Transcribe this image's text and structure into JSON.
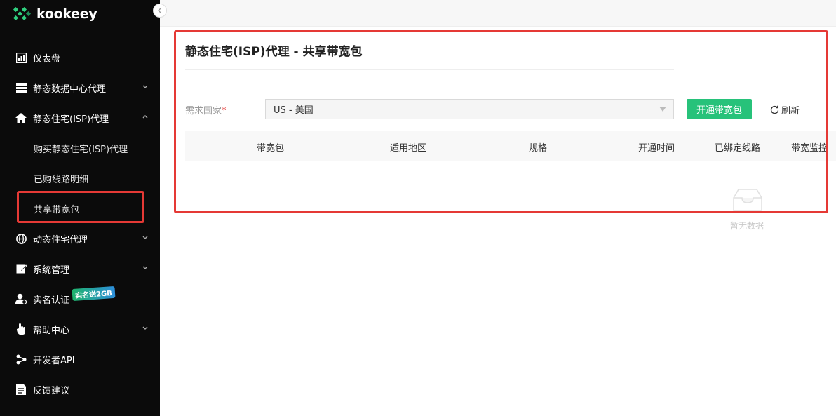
{
  "brand": {
    "name": "kookeey"
  },
  "sidebar": {
    "items": [
      {
        "label": "仪表盘",
        "icon": "dashboard-chart-icon",
        "expandable": false
      },
      {
        "label": "静态数据中心代理",
        "icon": "server-list-icon",
        "expandable": true,
        "expanded": false
      },
      {
        "label": "静态住宅(ISP)代理",
        "icon": "home-icon",
        "expandable": true,
        "expanded": true
      },
      {
        "label": "动态住宅代理",
        "icon": "globe-icon",
        "expandable": true,
        "expanded": false
      },
      {
        "label": "系统管理",
        "icon": "edit-icon",
        "expandable": true,
        "expanded": false
      },
      {
        "label": "实名认证",
        "icon": "user-verify-icon",
        "expandable": false
      },
      {
        "label": "帮助中心",
        "icon": "hand-pointer-icon",
        "expandable": true,
        "expanded": false
      },
      {
        "label": "开发者API",
        "icon": "share-nodes-icon",
        "expandable": false
      },
      {
        "label": "反馈建议",
        "icon": "feedback-doc-icon",
        "expandable": false
      }
    ],
    "submenu": [
      {
        "label": "购买静态住宅(ISP)代理"
      },
      {
        "label": "已购线路明细"
      },
      {
        "label": "共享带宽包",
        "active": true
      }
    ],
    "verify_badge": "实名送2GB"
  },
  "main": {
    "title": "静态住宅(ISP)代理 - 共享带宽包",
    "filter": {
      "label": "需求国家",
      "required_mark": "*",
      "selected": "US - 美国"
    },
    "actions": {
      "open_button": "开通带宽包",
      "refresh_button": "刷新"
    },
    "table": {
      "columns": [
        "带宽包",
        "适用地区",
        "规格",
        "开通时间",
        "已绑定线路",
        "带宽监控"
      ],
      "rows": [],
      "empty_text": "暂无数据"
    }
  },
  "colors": {
    "sidebar_bg": "#0b0b0b",
    "primary_green": "#27c27a",
    "highlight_red": "#e53935"
  }
}
